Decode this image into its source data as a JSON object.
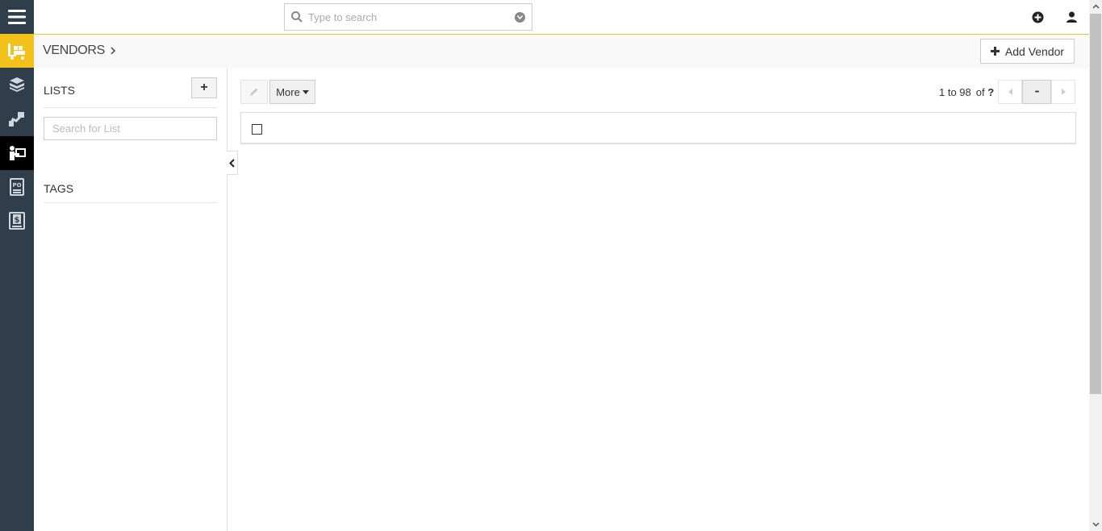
{
  "search": {
    "placeholder": "Type to search"
  },
  "header": {
    "title": "VENDORS",
    "add_button_label": "Add Vendor"
  },
  "lists": {
    "title": "LISTS",
    "add_label": "+",
    "search_placeholder": "Search for List"
  },
  "tags": {
    "title": "TAGS"
  },
  "toolbar": {
    "more_label": "More"
  },
  "pager": {
    "range": "1 to 98",
    "of_label": "of",
    "total": "?",
    "dots": "•••"
  },
  "rail": {
    "items": [
      "menu-icon",
      "forklift-icon",
      "boxes-icon",
      "hand-truck-icon",
      "vendor-icon",
      "purchase-order-icon",
      "invoice-icon"
    ],
    "accent": "#f2c21b",
    "active_bg": "#000000",
    "rail_bg": "#2f3e4a"
  }
}
